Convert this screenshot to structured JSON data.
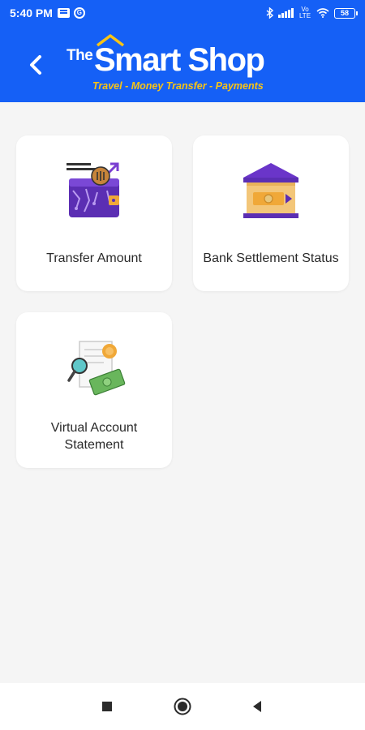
{
  "status_bar": {
    "time": "5:40 PM",
    "network_label": "Vo LTE",
    "battery": "58"
  },
  "header": {
    "logo_the": "The",
    "logo_main": "Smart Shop",
    "tagline": "Travel - Money Transfer - Payments",
    "back_icon": "chevron-left-icon"
  },
  "colors": {
    "brand_blue": "#1560f6",
    "tagline_yellow": "#f9c414",
    "accent_purple": "#5b2eb3"
  },
  "menu": {
    "items": [
      {
        "label": "Transfer Amount",
        "icon": "wallet-transfer-icon"
      },
      {
        "label": "Bank Settlement Status",
        "icon": "bank-icon"
      },
      {
        "label": "Virtual Account Statement",
        "icon": "statement-search-icon"
      }
    ]
  },
  "nav": {
    "recents": "recents-square-icon",
    "home": "home-circle-icon",
    "back": "back-triangle-icon"
  }
}
